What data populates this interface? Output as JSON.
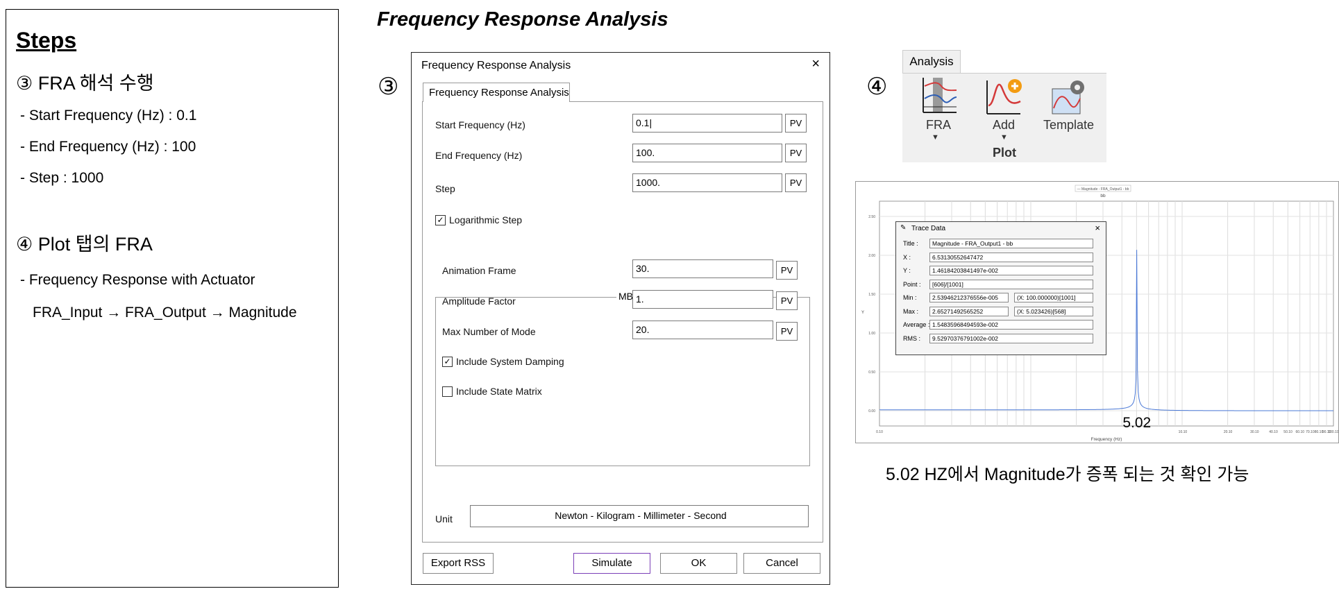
{
  "steps": {
    "heading": "Steps",
    "step3_title": "③ FRA 해석 수행",
    "step3_items": [
      "- Start Frequency (Hz) : 0.1",
      "- End Frequency (Hz) : 100",
      "- Step : 1000"
    ],
    "step4_title": "④ Plot 탭의 FRA",
    "step4_items": [
      "-  Frequency Response with Actuator",
      "FRA_Input → FRA_Output → Magnitude"
    ]
  },
  "section_title": "Frequency Response Analysis",
  "markers": {
    "three": "③",
    "four": "④"
  },
  "dialog": {
    "title": "Frequency Response Analysis",
    "close": "×",
    "tab": "Frequency Response Analysis",
    "fields": [
      {
        "label": "Start Frequency (Hz)",
        "value": "0.1|",
        "pv": "PV"
      },
      {
        "label": "End Frequency (Hz)",
        "value": "100.",
        "pv": "PV"
      },
      {
        "label": "Step",
        "value": "1000.",
        "pv": "PV"
      }
    ],
    "log_step": {
      "label": "Logarithmic Step",
      "checked": true
    },
    "group_label": "MBD/ RFLEX",
    "group_fields": [
      {
        "label": "Animation Frame",
        "value": "30.",
        "pv": "PV"
      },
      {
        "label": "Amplitude Factor",
        "value": "1.",
        "pv": "PV"
      },
      {
        "label": "Max Number of Mode",
        "value": "20.",
        "pv": "PV"
      }
    ],
    "sys_damping": {
      "label": "Include System Damping",
      "checked": true
    },
    "state_matrix": {
      "label": "Include State Matrix",
      "checked": false
    },
    "unit_label": "Unit",
    "unit_value": "Newton - Kilogram - Millimeter - Second",
    "buttons": {
      "export": "Export RSS",
      "simulate": "Simulate",
      "ok": "OK",
      "cancel": "Cancel"
    }
  },
  "ribbon": {
    "tab": "Analysis",
    "fra": "FRA",
    "add": "Add",
    "template": "Template",
    "group": "Plot"
  },
  "chart_data": {
    "type": "line",
    "title": "bb",
    "legend": "— Magnitude - FRA_Output1 - bb",
    "xlabel": "Frequency (Hz)",
    "ylabel": "Y",
    "x_scale": "log",
    "xlim": [
      0.1,
      100
    ],
    "peak": {
      "x": 5.02,
      "label": "5.02"
    },
    "y_ticks": [
      "2.50",
      "2.00",
      "1.50",
      "1.00",
      "0.50",
      "0.00"
    ],
    "x_ticks": [
      "0.10",
      "10.10",
      "20.10",
      "30.10",
      "40.10",
      "50.10",
      "60.10",
      "70.10",
      "80.10",
      "90.10",
      "100.10"
    ],
    "grid": true,
    "colors": {
      "line": "#4a78d6"
    }
  },
  "trace": {
    "title": "Trace Data",
    "close": "×",
    "rows": [
      {
        "key": "Title :",
        "val": "Magnitude - FRA_Output1 - bb"
      },
      {
        "key": "X :",
        "val": "6.53130552647472"
      },
      {
        "key": "Y :",
        "val": "1.46184203841497e-002"
      },
      {
        "key": "Point :",
        "val": "[606]/[1001]"
      },
      {
        "key": "Min :",
        "val": "2.53946212376556e-005",
        "extra": "(X: 100.000000)[1001]"
      },
      {
        "key": "Max :",
        "val": "2.65271492565252",
        "extra": "(X: 5.023426)[568]"
      },
      {
        "key": "Average :",
        "val": "1.54835968494593e-002"
      },
      {
        "key": "RMS :",
        "val": "9.52970376791002e-002"
      }
    ]
  },
  "caption": "5.02 HZ에서 Magnitude가 증폭 되는 것 확인 가능"
}
